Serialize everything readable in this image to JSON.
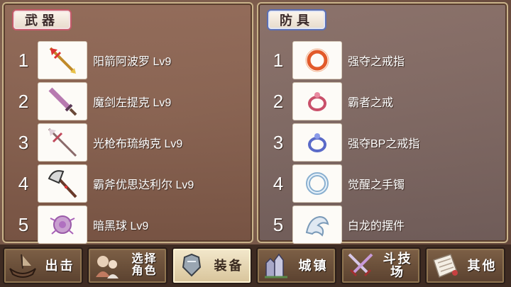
{
  "weapons": {
    "tab_label": "武器",
    "items": [
      {
        "rank": "1",
        "name": "阳箭阿波罗 Lv9",
        "icon": "golden-arrow-icon"
      },
      {
        "rank": "2",
        "name": "魔剑左提克 Lv9",
        "icon": "magic-sword-icon"
      },
      {
        "rank": "3",
        "name": "光枪布琉纳克 Lv9",
        "icon": "light-spear-icon"
      },
      {
        "rank": "4",
        "name": "霸斧优思达利尔 Lv9",
        "icon": "battle-axe-icon"
      },
      {
        "rank": "5",
        "name": "暗黑球 Lv9",
        "icon": "dark-orb-icon"
      }
    ]
  },
  "armor": {
    "tab_label": "防具",
    "items": [
      {
        "rank": "1",
        "name": "强夺之戒指",
        "icon": "red-ring-icon"
      },
      {
        "rank": "2",
        "name": "霸者之戒",
        "icon": "pink-ring-icon"
      },
      {
        "rank": "3",
        "name": "强夺BP之戒指",
        "icon": "blue-ring-icon"
      },
      {
        "rank": "4",
        "name": "觉醒之手镯",
        "icon": "silver-bracelet-icon"
      },
      {
        "rank": "5",
        "name": "白龙的摆件",
        "icon": "white-dragon-icon"
      }
    ]
  },
  "nav": {
    "sortie": "出击",
    "select_line1": "选择",
    "select_line2": "角色",
    "equipment": "装备",
    "town": "城镇",
    "arena": "斗技场",
    "other": "其他"
  },
  "colors": {
    "weapon_tab_border": "#c45a6a",
    "armor_tab_border": "#5b6fb4",
    "active_button": "#f3e8cc"
  }
}
